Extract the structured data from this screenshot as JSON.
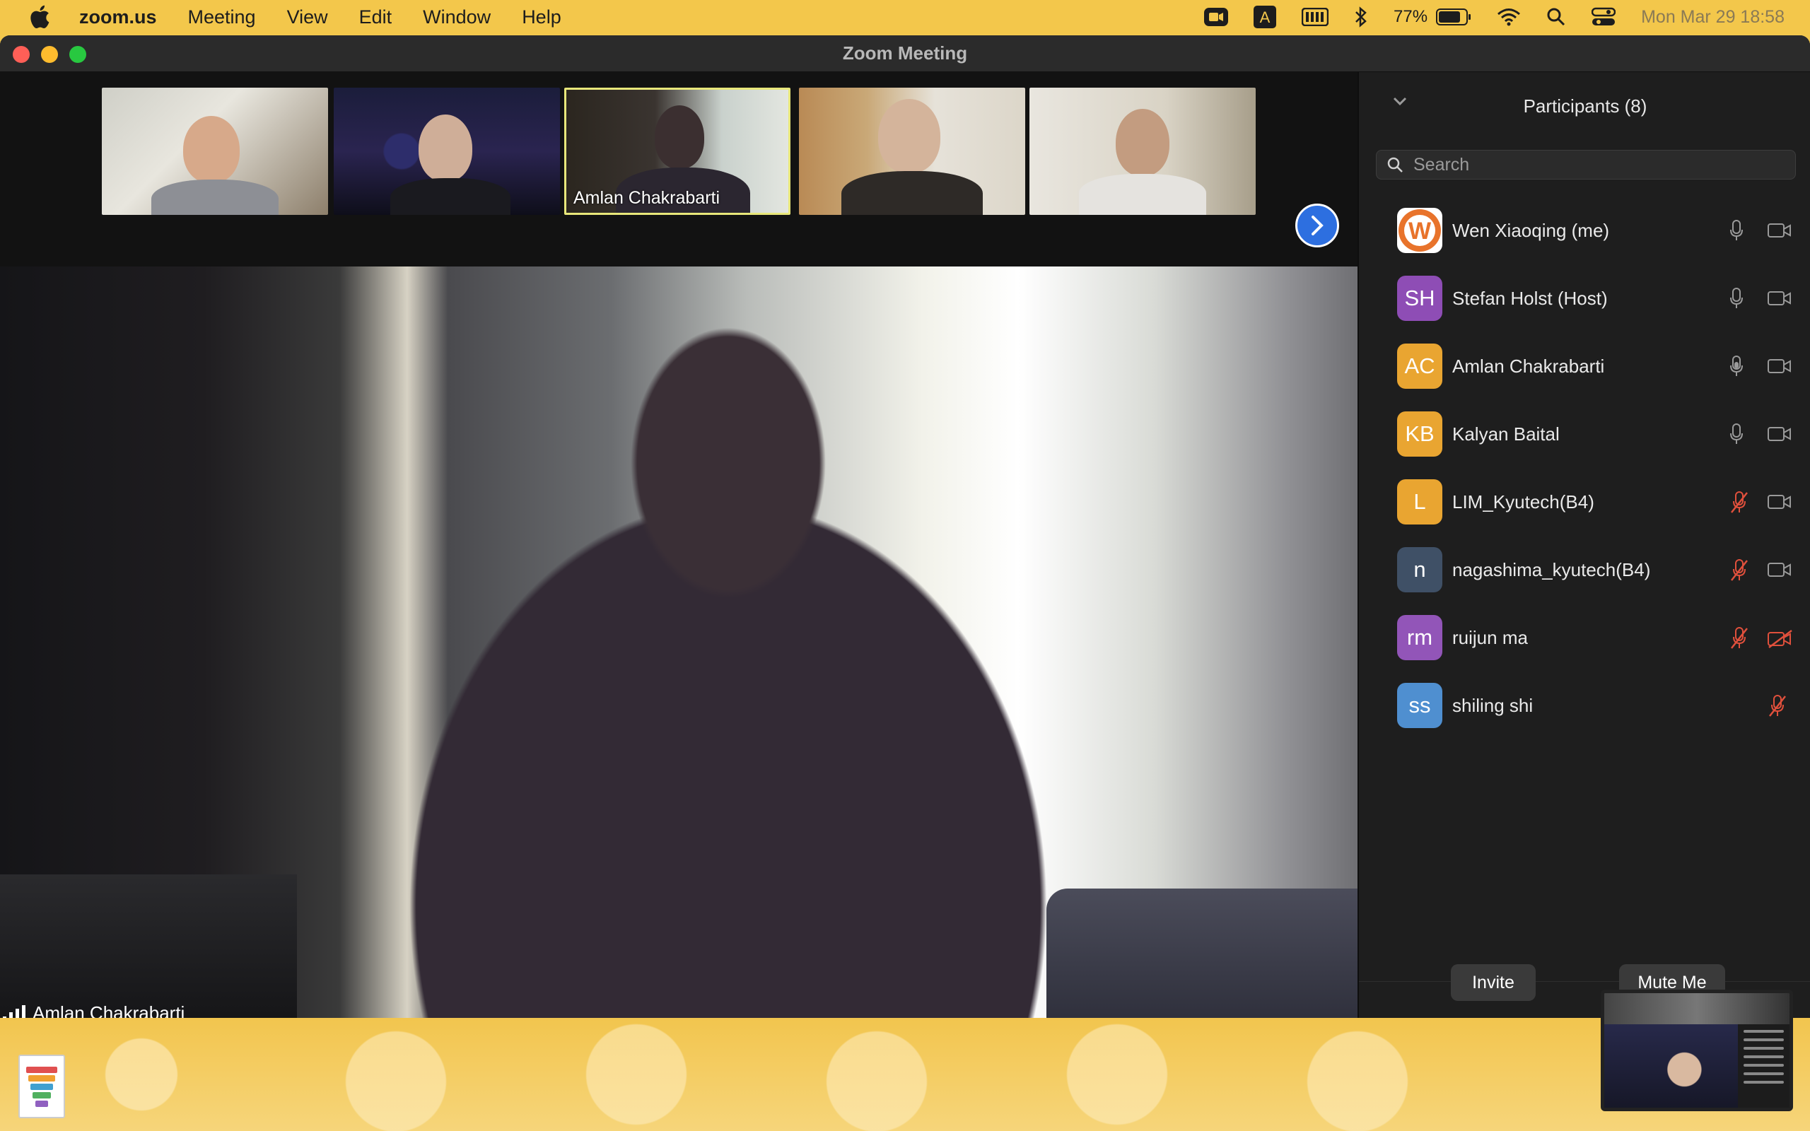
{
  "menubar": {
    "app": "zoom.us",
    "items": [
      "Meeting",
      "View",
      "Edit",
      "Window",
      "Help"
    ],
    "battery": "77%",
    "clock": "Mon Mar 29  18:58"
  },
  "window": {
    "title": "Zoom Meeting"
  },
  "thumbnails": {
    "active_name": "Amlan Chakrabarti"
  },
  "main_video": {
    "speaker_name": "Amlan Chakrabarti"
  },
  "participants": {
    "title": "Participants (8)",
    "search_placeholder": "Search",
    "items": [
      {
        "initials": "W",
        "name": "Wen Xiaoqing (me)",
        "color": "#ffffff",
        "mic": "on",
        "video": "on"
      },
      {
        "initials": "SH",
        "name": "Stefan Holst (Host)",
        "color": "#8e4db5",
        "mic": "on",
        "video": "on"
      },
      {
        "initials": "AC",
        "name": "Amlan Chakrabarti",
        "color": "#e9a531",
        "mic": "on",
        "video": "on"
      },
      {
        "initials": "KB",
        "name": "Kalyan Baital",
        "color": "#e9a531",
        "mic": "on",
        "video": "on"
      },
      {
        "initials": "L",
        "name": "LIM_Kyutech(B4)",
        "color": "#e9a531",
        "mic": "muted",
        "video": "on"
      },
      {
        "initials": "n",
        "name": "nagashima_kyutech(B4)",
        "color": "#3f5066",
        "mic": "muted",
        "video": "on"
      },
      {
        "initials": "rm",
        "name": "ruijun ma",
        "color": "#9255b8",
        "mic": "muted",
        "video": "off"
      },
      {
        "initials": "ss",
        "name": "shiling shi",
        "color": "#4f8fd0",
        "mic": "muted",
        "video": "none"
      }
    ],
    "invite_label": "Invite",
    "mute_label": "Mute Me"
  },
  "colors": {
    "muted_icon": "#e0503c",
    "icon_gray": "#9a9a9a",
    "accent_blue": "#2d6fe0",
    "active_border": "#e8e77a"
  }
}
